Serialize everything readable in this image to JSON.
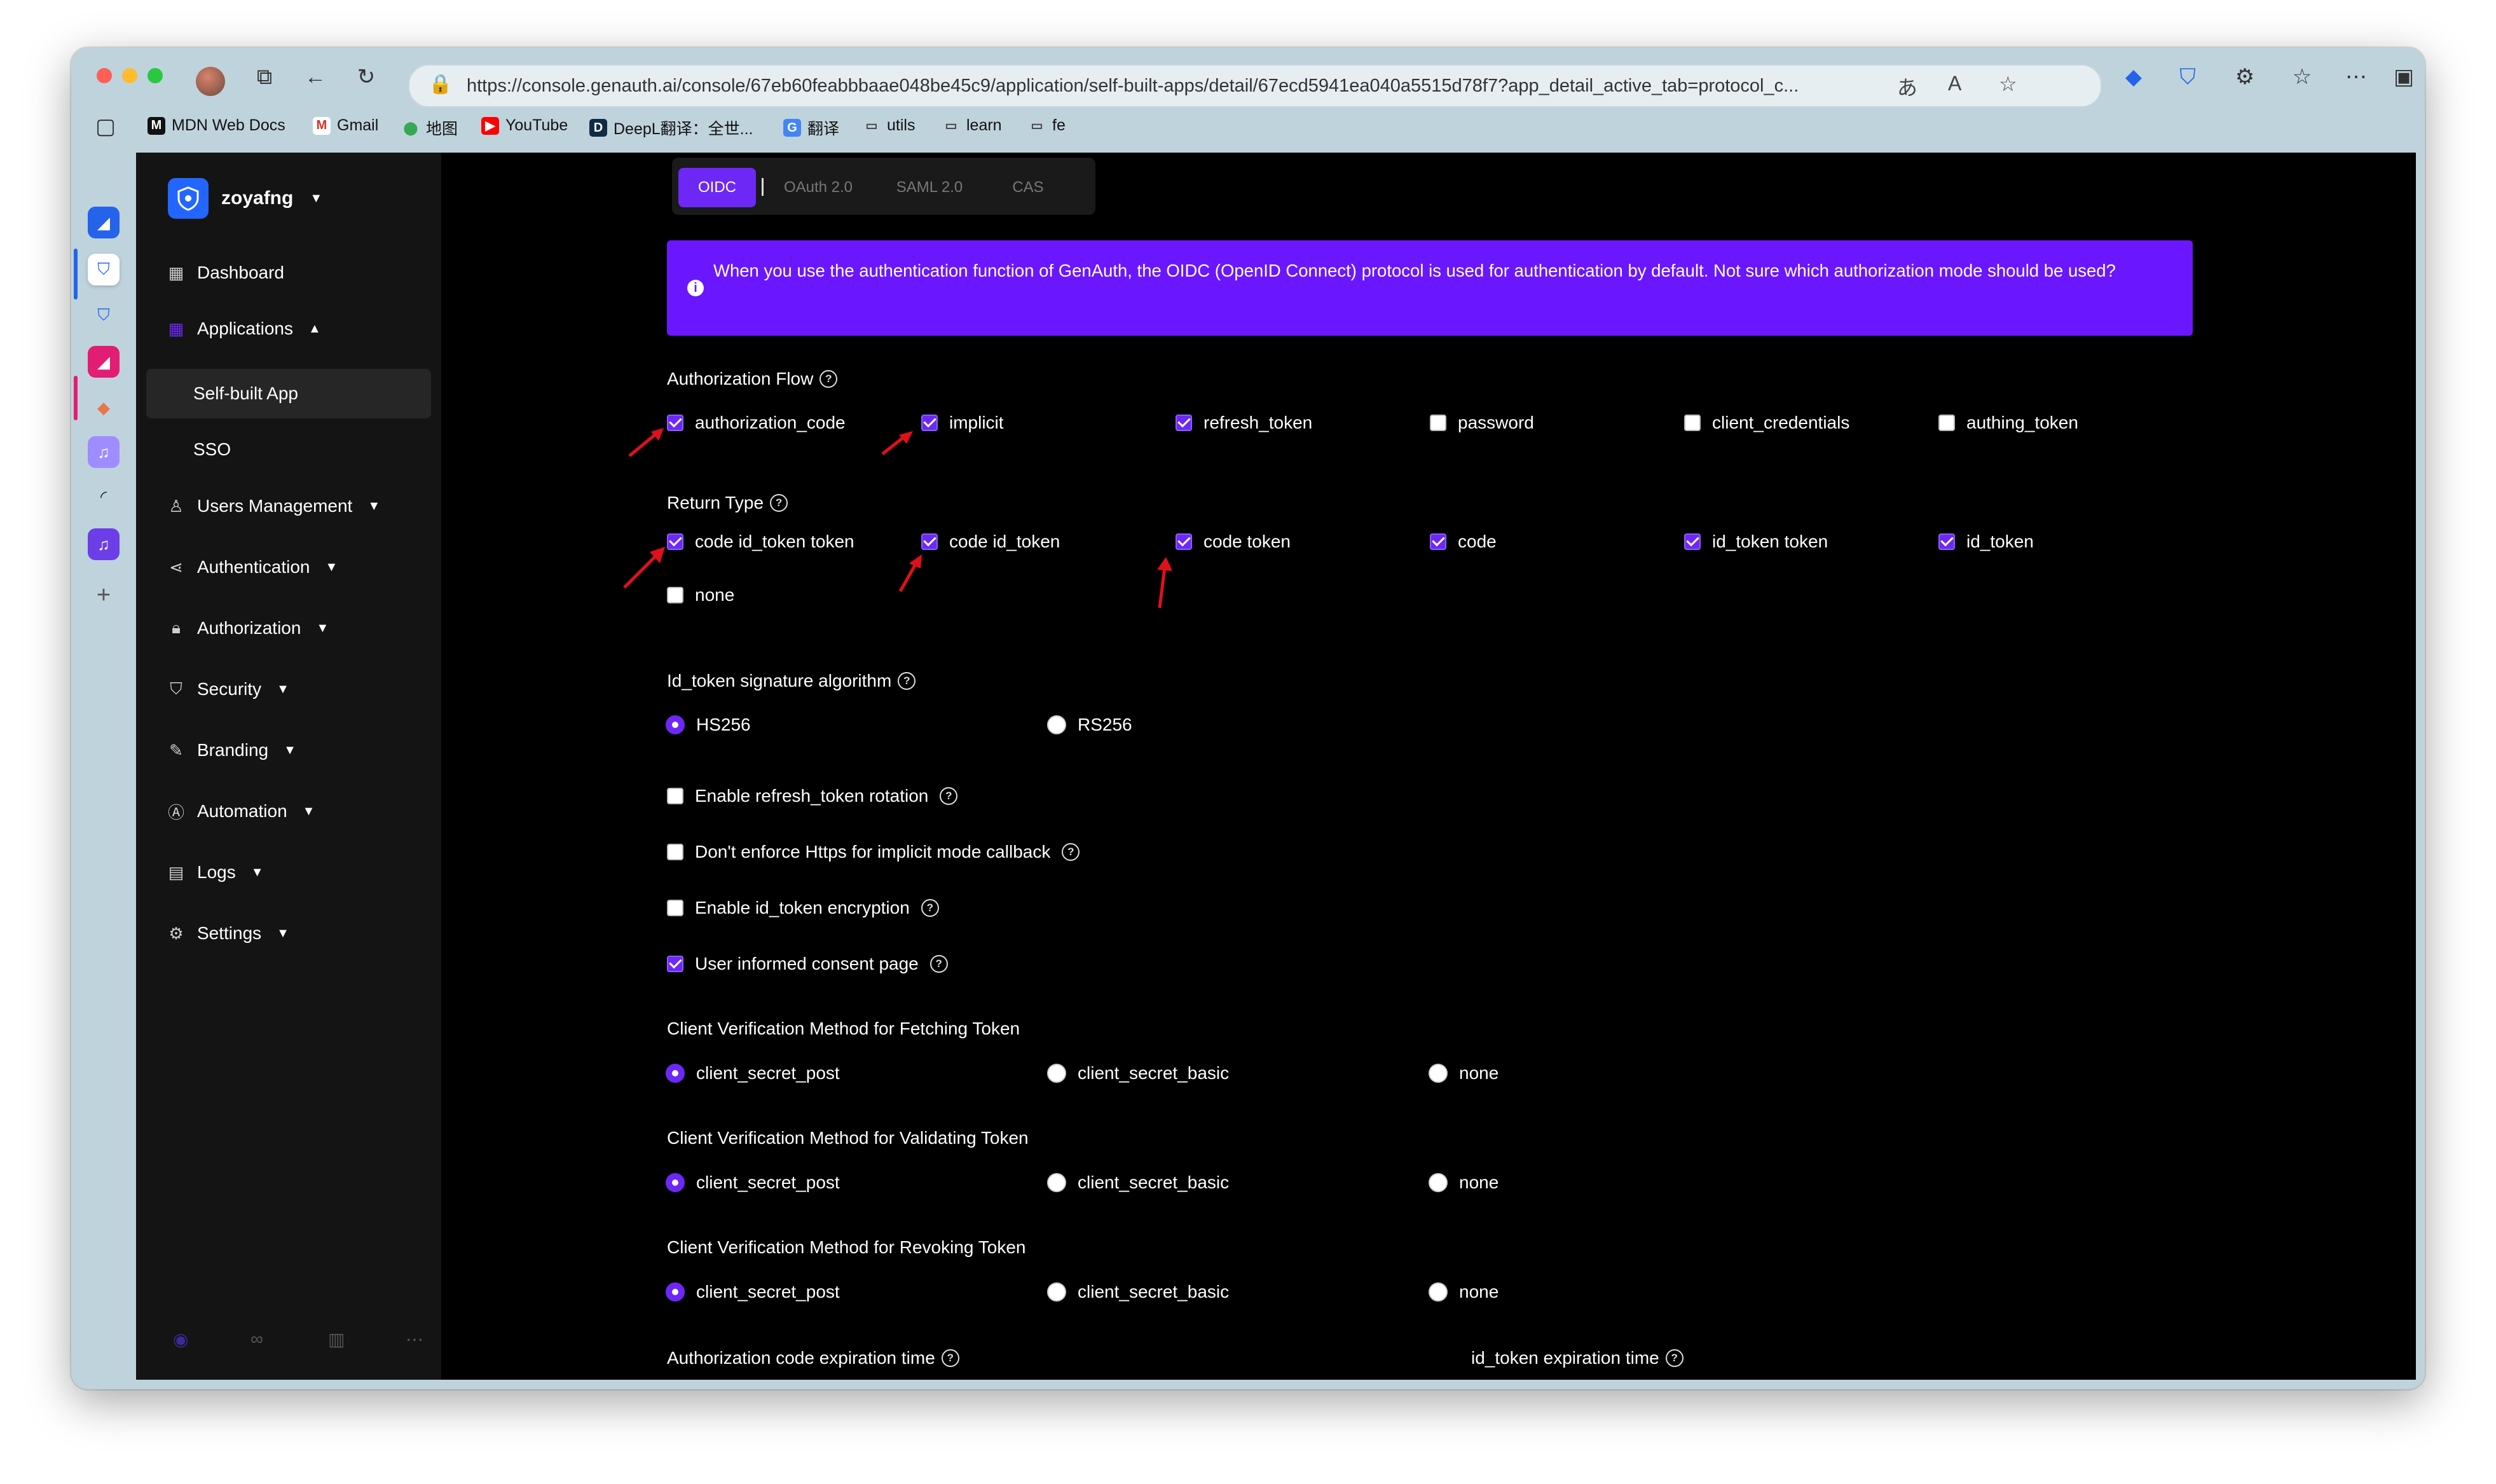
{
  "browser": {
    "url": "https://console.genauth.ai/console/67eb60feabbbaae048be45c9/application/self-built-apps/detail/67ecd5941ea040a5515d78f7?app_detail_active_tab=protocol_c...",
    "bookmarks": [
      "MDN Web Docs",
      "Gmail",
      "地图",
      "YouTube",
      "DeepL翻译：全世...",
      "翻译",
      "utils",
      "learn",
      "fe"
    ]
  },
  "sidebar": {
    "org_name": "zoyafng",
    "items": [
      {
        "label": "Dashboard"
      },
      {
        "label": "Applications"
      },
      {
        "label": "Self-built App"
      },
      {
        "label": "SSO"
      },
      {
        "label": "Users Management"
      },
      {
        "label": "Authentication"
      },
      {
        "label": "Authorization"
      },
      {
        "label": "Security"
      },
      {
        "label": "Branding"
      },
      {
        "label": "Automation"
      },
      {
        "label": "Logs"
      },
      {
        "label": "Settings"
      }
    ]
  },
  "protocol_tabs": [
    "OIDC",
    "OAuth 2.0",
    "SAML 2.0",
    "CAS"
  ],
  "banner_text": "When you use the authentication function of GenAuth, the OIDC (OpenID Connect) protocol is used for authentication by default. Not sure which authorization mode should be used?",
  "authorization_flow": {
    "label": "Authorization Flow",
    "options": [
      {
        "label": "authorization_code",
        "checked": true
      },
      {
        "label": "implicit",
        "checked": true
      },
      {
        "label": "refresh_token",
        "checked": true
      },
      {
        "label": "password",
        "checked": false
      },
      {
        "label": "client_credentials",
        "checked": false
      },
      {
        "label": "authing_token",
        "checked": false
      }
    ]
  },
  "return_type": {
    "label": "Return Type",
    "options": [
      {
        "label": "code id_token token",
        "checked": true
      },
      {
        "label": "code id_token",
        "checked": true
      },
      {
        "label": "code token",
        "checked": true
      },
      {
        "label": "code",
        "checked": true
      },
      {
        "label": "id_token token",
        "checked": true
      },
      {
        "label": "id_token",
        "checked": true
      },
      {
        "label": "none",
        "checked": false
      }
    ]
  },
  "signature": {
    "label": "Id_token signature algorithm",
    "options": [
      {
        "label": "HS256",
        "selected": true
      },
      {
        "label": "RS256",
        "selected": false
      }
    ]
  },
  "toggles": [
    {
      "label": "Enable refresh_token rotation",
      "checked": false
    },
    {
      "label": "Don't enforce Https for implicit mode callback",
      "checked": false
    },
    {
      "label": "Enable id_token encryption",
      "checked": false
    },
    {
      "label": "User informed consent page",
      "checked": true
    }
  ],
  "verification": [
    {
      "label": "Client Verification Method for Fetching Token",
      "options": [
        "client_secret_post",
        "client_secret_basic",
        "none"
      ],
      "selected": "client_secret_post"
    },
    {
      "label": "Client Verification Method for Validating Token",
      "options": [
        "client_secret_post",
        "client_secret_basic",
        "none"
      ],
      "selected": "client_secret_post"
    },
    {
      "label": "Client Verification Method for Revoking Token",
      "options": [
        "client_secret_post",
        "client_secret_basic",
        "none"
      ],
      "selected": "client_secret_post"
    }
  ],
  "expiration": {
    "auth_code_label": "Authorization code expiration time",
    "id_token_label": "id_token expiration time"
  },
  "colors": {
    "accent": "#6d28f5",
    "banner": "#6a17ff",
    "annotation_arrow": "#e0101a"
  }
}
